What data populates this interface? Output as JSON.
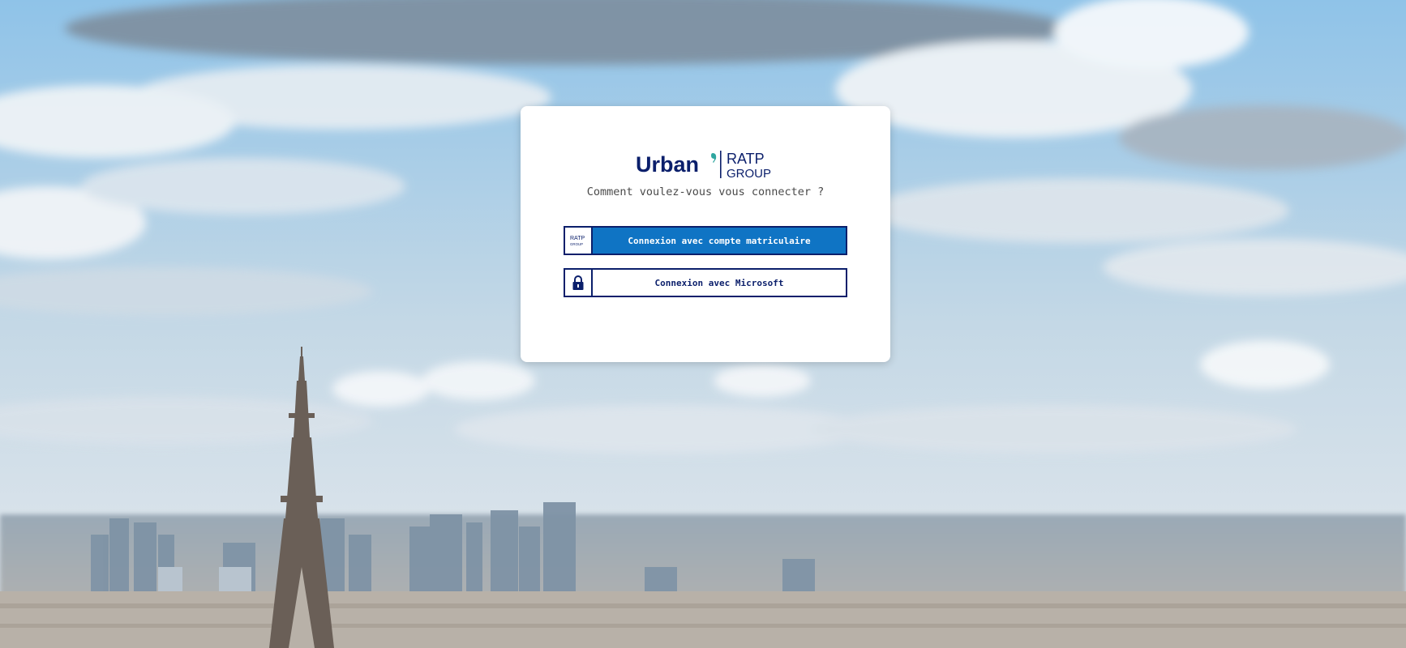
{
  "brand": {
    "urban_text": "Urban",
    "ratp_text": "RATP",
    "group_text": "GROUP",
    "colors": {
      "navy": "#0b1f6b",
      "primary_blue": "#0f74c4",
      "teal": "#2fa6a0"
    }
  },
  "login": {
    "prompt": "Comment voulez-vous vous connecter ?",
    "options": [
      {
        "label": "Connexion avec compte matriculaire",
        "icon": "ratp-group-logo-icon",
        "icon_text_top": "RATP",
        "icon_text_bottom": "GROUP"
      },
      {
        "label": "Connexion avec Microsoft",
        "icon": "lock-icon"
      }
    ]
  }
}
